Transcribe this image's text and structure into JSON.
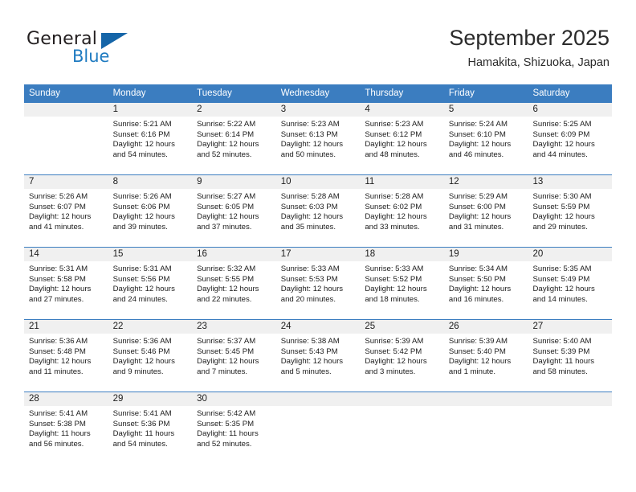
{
  "brand": {
    "word_one": "General",
    "word_two": "Blue",
    "triangle_icon": "triangle-logo-icon",
    "color_primary": "#1565a8",
    "color_text": "#231f20"
  },
  "header": {
    "title": "September 2025",
    "location": "Hamakita, Shizuoka, Japan"
  },
  "theme": {
    "header_blue": "#3b7dc0",
    "daynum_bg": "#f0f0f0",
    "text": "#1c1c1c"
  },
  "weekdays": [
    "Sunday",
    "Monday",
    "Tuesday",
    "Wednesday",
    "Thursday",
    "Friday",
    "Saturday"
  ],
  "labels": {
    "sunrise_prefix": "Sunrise:",
    "sunset_prefix": "Sunset:",
    "daylight_prefix": "Daylight:"
  },
  "weeks": [
    [
      {
        "day": "",
        "line1": "",
        "line2": "",
        "line3": "",
        "line4": ""
      },
      {
        "day": "1",
        "line1": "Sunrise: 5:21 AM",
        "line2": "Sunset: 6:16 PM",
        "line3": "Daylight: 12 hours",
        "line4": "and 54 minutes."
      },
      {
        "day": "2",
        "line1": "Sunrise: 5:22 AM",
        "line2": "Sunset: 6:14 PM",
        "line3": "Daylight: 12 hours",
        "line4": "and 52 minutes."
      },
      {
        "day": "3",
        "line1": "Sunrise: 5:23 AM",
        "line2": "Sunset: 6:13 PM",
        "line3": "Daylight: 12 hours",
        "line4": "and 50 minutes."
      },
      {
        "day": "4",
        "line1": "Sunrise: 5:23 AM",
        "line2": "Sunset: 6:12 PM",
        "line3": "Daylight: 12 hours",
        "line4": "and 48 minutes."
      },
      {
        "day": "5",
        "line1": "Sunrise: 5:24 AM",
        "line2": "Sunset: 6:10 PM",
        "line3": "Daylight: 12 hours",
        "line4": "and 46 minutes."
      },
      {
        "day": "6",
        "line1": "Sunrise: 5:25 AM",
        "line2": "Sunset: 6:09 PM",
        "line3": "Daylight: 12 hours",
        "line4": "and 44 minutes."
      }
    ],
    [
      {
        "day": "7",
        "line1": "Sunrise: 5:26 AM",
        "line2": "Sunset: 6:07 PM",
        "line3": "Daylight: 12 hours",
        "line4": "and 41 minutes."
      },
      {
        "day": "8",
        "line1": "Sunrise: 5:26 AM",
        "line2": "Sunset: 6:06 PM",
        "line3": "Daylight: 12 hours",
        "line4": "and 39 minutes."
      },
      {
        "day": "9",
        "line1": "Sunrise: 5:27 AM",
        "line2": "Sunset: 6:05 PM",
        "line3": "Daylight: 12 hours",
        "line4": "and 37 minutes."
      },
      {
        "day": "10",
        "line1": "Sunrise: 5:28 AM",
        "line2": "Sunset: 6:03 PM",
        "line3": "Daylight: 12 hours",
        "line4": "and 35 minutes."
      },
      {
        "day": "11",
        "line1": "Sunrise: 5:28 AM",
        "line2": "Sunset: 6:02 PM",
        "line3": "Daylight: 12 hours",
        "line4": "and 33 minutes."
      },
      {
        "day": "12",
        "line1": "Sunrise: 5:29 AM",
        "line2": "Sunset: 6:00 PM",
        "line3": "Daylight: 12 hours",
        "line4": "and 31 minutes."
      },
      {
        "day": "13",
        "line1": "Sunrise: 5:30 AM",
        "line2": "Sunset: 5:59 PM",
        "line3": "Daylight: 12 hours",
        "line4": "and 29 minutes."
      }
    ],
    [
      {
        "day": "14",
        "line1": "Sunrise: 5:31 AM",
        "line2": "Sunset: 5:58 PM",
        "line3": "Daylight: 12 hours",
        "line4": "and 27 minutes."
      },
      {
        "day": "15",
        "line1": "Sunrise: 5:31 AM",
        "line2": "Sunset: 5:56 PM",
        "line3": "Daylight: 12 hours",
        "line4": "and 24 minutes."
      },
      {
        "day": "16",
        "line1": "Sunrise: 5:32 AM",
        "line2": "Sunset: 5:55 PM",
        "line3": "Daylight: 12 hours",
        "line4": "and 22 minutes."
      },
      {
        "day": "17",
        "line1": "Sunrise: 5:33 AM",
        "line2": "Sunset: 5:53 PM",
        "line3": "Daylight: 12 hours",
        "line4": "and 20 minutes."
      },
      {
        "day": "18",
        "line1": "Sunrise: 5:33 AM",
        "line2": "Sunset: 5:52 PM",
        "line3": "Daylight: 12 hours",
        "line4": "and 18 minutes."
      },
      {
        "day": "19",
        "line1": "Sunrise: 5:34 AM",
        "line2": "Sunset: 5:50 PM",
        "line3": "Daylight: 12 hours",
        "line4": "and 16 minutes."
      },
      {
        "day": "20",
        "line1": "Sunrise: 5:35 AM",
        "line2": "Sunset: 5:49 PM",
        "line3": "Daylight: 12 hours",
        "line4": "and 14 minutes."
      }
    ],
    [
      {
        "day": "21",
        "line1": "Sunrise: 5:36 AM",
        "line2": "Sunset: 5:48 PM",
        "line3": "Daylight: 12 hours",
        "line4": "and 11 minutes."
      },
      {
        "day": "22",
        "line1": "Sunrise: 5:36 AM",
        "line2": "Sunset: 5:46 PM",
        "line3": "Daylight: 12 hours",
        "line4": "and 9 minutes."
      },
      {
        "day": "23",
        "line1": "Sunrise: 5:37 AM",
        "line2": "Sunset: 5:45 PM",
        "line3": "Daylight: 12 hours",
        "line4": "and 7 minutes."
      },
      {
        "day": "24",
        "line1": "Sunrise: 5:38 AM",
        "line2": "Sunset: 5:43 PM",
        "line3": "Daylight: 12 hours",
        "line4": "and 5 minutes."
      },
      {
        "day": "25",
        "line1": "Sunrise: 5:39 AM",
        "line2": "Sunset: 5:42 PM",
        "line3": "Daylight: 12 hours",
        "line4": "and 3 minutes."
      },
      {
        "day": "26",
        "line1": "Sunrise: 5:39 AM",
        "line2": "Sunset: 5:40 PM",
        "line3": "Daylight: 12 hours",
        "line4": "and 1 minute."
      },
      {
        "day": "27",
        "line1": "Sunrise: 5:40 AM",
        "line2": "Sunset: 5:39 PM",
        "line3": "Daylight: 11 hours",
        "line4": "and 58 minutes."
      }
    ],
    [
      {
        "day": "28",
        "line1": "Sunrise: 5:41 AM",
        "line2": "Sunset: 5:38 PM",
        "line3": "Daylight: 11 hours",
        "line4": "and 56 minutes."
      },
      {
        "day": "29",
        "line1": "Sunrise: 5:41 AM",
        "line2": "Sunset: 5:36 PM",
        "line3": "Daylight: 11 hours",
        "line4": "and 54 minutes."
      },
      {
        "day": "30",
        "line1": "Sunrise: 5:42 AM",
        "line2": "Sunset: 5:35 PM",
        "line3": "Daylight: 11 hours",
        "line4": "and 52 minutes."
      },
      {
        "day": "",
        "line1": "",
        "line2": "",
        "line3": "",
        "line4": ""
      },
      {
        "day": "",
        "line1": "",
        "line2": "",
        "line3": "",
        "line4": ""
      },
      {
        "day": "",
        "line1": "",
        "line2": "",
        "line3": "",
        "line4": ""
      },
      {
        "day": "",
        "line1": "",
        "line2": "",
        "line3": "",
        "line4": ""
      }
    ]
  ]
}
